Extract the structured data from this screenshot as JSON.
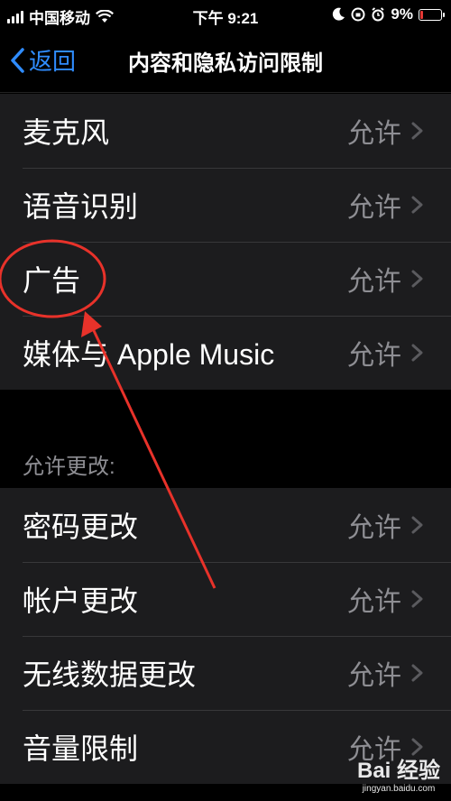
{
  "status_bar": {
    "carrier": "中国移动",
    "time": "下午 9:21",
    "battery_percent": "9%"
  },
  "nav": {
    "back_label": "返回",
    "title": "内容和隐私访问限制"
  },
  "group1": [
    {
      "label": "麦克风",
      "value": "允许"
    },
    {
      "label": "语音识别",
      "value": "允许"
    },
    {
      "label": "广告",
      "value": "允许"
    },
    {
      "label": "媒体与 Apple Music",
      "value": "允许"
    }
  ],
  "section2_header": "允许更改:",
  "group2": [
    {
      "label": "密码更改",
      "value": "允许"
    },
    {
      "label": "帐户更改",
      "value": "允许"
    },
    {
      "label": "无线数据更改",
      "value": "允许"
    },
    {
      "label": "音量限制",
      "value": "允许"
    }
  ],
  "watermark": {
    "brand": "Bai 经验",
    "url": "jingyan.baidu.com"
  },
  "colors": {
    "accent": "#2f8cff",
    "annotation": "#e8322a",
    "battery_low": "#e53935"
  }
}
